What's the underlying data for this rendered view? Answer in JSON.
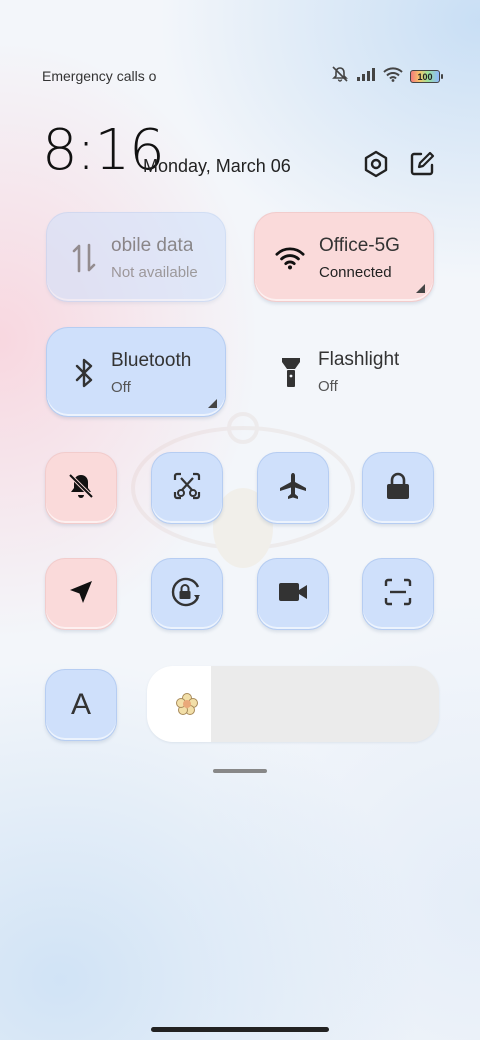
{
  "status_bar": {
    "carrier_text": "Emergency calls o",
    "icons": [
      "mute-icon",
      "signal-icon",
      "wifi-icon",
      "battery-icon"
    ],
    "battery_level": "100"
  },
  "header": {
    "time": "8:16",
    "date": "Monday, March 06",
    "icons": [
      "settings-icon",
      "edit-icon"
    ]
  },
  "tiles": {
    "mobile_data": {
      "title": "obile data",
      "subtitle": "Not available",
      "icon": "mobile-data-icon",
      "active": false
    },
    "wifi": {
      "title": "Office-5G",
      "subtitle": "Connected",
      "icon": "wifi-icon",
      "active": true
    },
    "bluetooth": {
      "title": "Bluetooth",
      "subtitle": "Off",
      "icon": "bluetooth-icon",
      "active": false
    },
    "flashlight": {
      "title": "Flashlight",
      "subtitle": "Off",
      "icon": "flashlight-icon",
      "active": false
    }
  },
  "toggles_row1": [
    "mute-toggle",
    "screenshot-toggle",
    "airplane-toggle",
    "lock-toggle"
  ],
  "toggles_row2": [
    "location-toggle",
    "rotation-lock-toggle",
    "video-toggle",
    "scan-toggle"
  ],
  "font_button": {
    "label": "A"
  },
  "brightness": {
    "level": 0.22
  },
  "colors": {
    "tile_blue": "#cfe0fb",
    "tile_pink": "#fadada",
    "icon_dark": "#333333"
  }
}
